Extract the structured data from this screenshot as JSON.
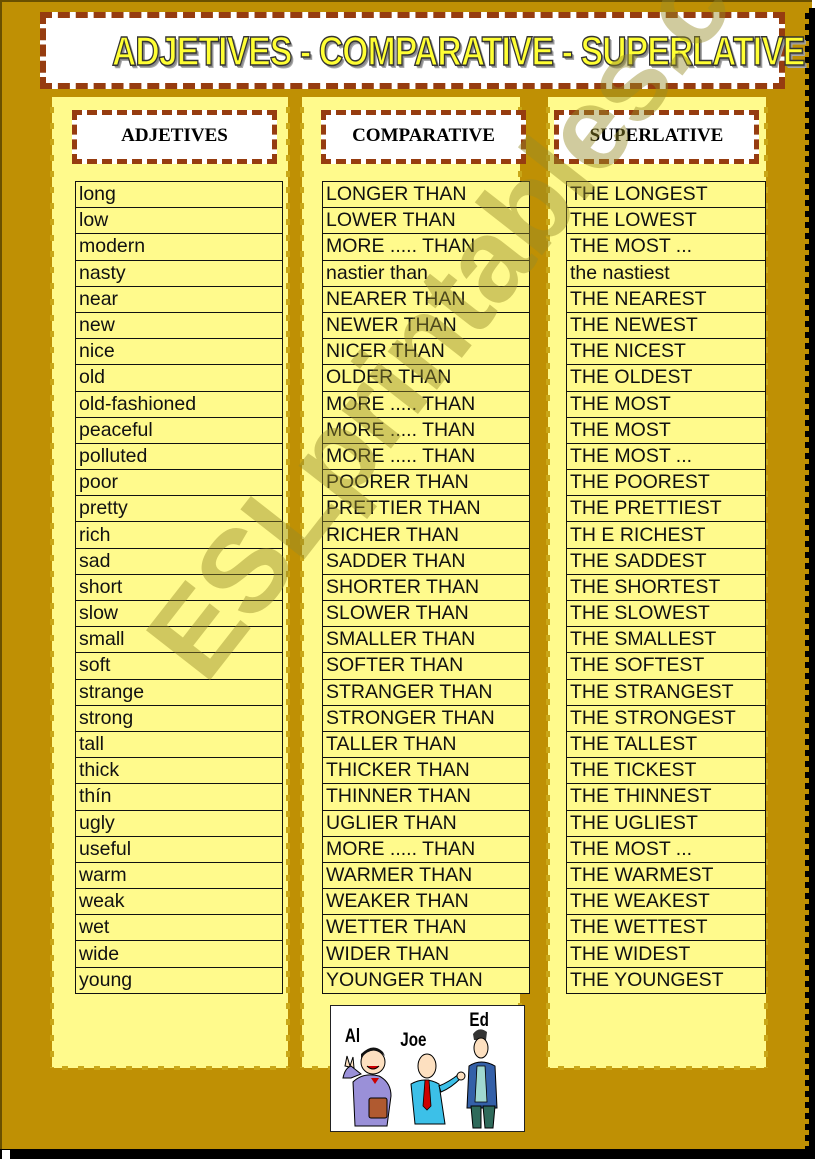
{
  "title": "ADJETIVES - COMPARATIVE - SUPERLATIVE",
  "columns": {
    "adjectives": "ADJETIVES",
    "comparative": "COMPARATIVE",
    "superlative": "SUPERLATIVE"
  },
  "rows": [
    {
      "adj": "long",
      "comp": "LONGER THAN",
      "sup": "THE LONGEST"
    },
    {
      "adj": "low",
      "comp": "LOWER THAN",
      "sup": "THE  LOWEST"
    },
    {
      "adj": "modern",
      "comp": "MORE ..... THAN",
      "sup": "THE  MOST ..."
    },
    {
      "adj": "nasty",
      "comp": "nastier than",
      "sup": "the nastiest"
    },
    {
      "adj": "near",
      "comp": "NEARER THAN",
      "sup": "THE NEAREST"
    },
    {
      "adj": "new",
      "comp": "NEWER THAN",
      "sup": "THE NEWEST"
    },
    {
      "adj": "nice",
      "comp": "NICER THAN",
      "sup": "THE NICEST"
    },
    {
      "adj": "old",
      "comp": "OLDER THAN",
      "sup": "THE OLDEST"
    },
    {
      "adj": "old-fashioned",
      "comp": "MORE ..... THAN",
      "sup": "THE MOST"
    },
    {
      "adj": "peaceful",
      "comp": "MORE ..... THAN",
      "sup": "THE MOST"
    },
    {
      "adj": "polluted",
      "comp": "MORE ..... THAN",
      "sup": "THE  MOST ..."
    },
    {
      "adj": "poor",
      "comp": "POORER THAN",
      "sup": "THE POOREST"
    },
    {
      "adj": "pretty",
      "comp": "PRETTIER THAN",
      "sup": "THE PRETTIEST"
    },
    {
      "adj": "rich",
      "comp": "RICHER THAN",
      "sup": "TH E RICHEST"
    },
    {
      "adj": "sad",
      "comp": "SADDER THAN",
      "sup": "THE SADDEST"
    },
    {
      "adj": "short",
      "comp": "SHORTER THAN",
      "sup": "THE SHORTEST"
    },
    {
      "adj": "slow",
      "comp": "SLOWER THAN",
      "sup": "THE SLOWEST"
    },
    {
      "adj": "small",
      "comp": "SMALLER THAN",
      "sup": "THE SMALLEST"
    },
    {
      "adj": "soft",
      "comp": "SOFTER THAN",
      "sup": "THE SOFTEST"
    },
    {
      "adj": "strange",
      "comp": "STRANGER THAN",
      "sup": "THE STRANGEST"
    },
    {
      "adj": "strong",
      "comp": "STRONGER THAN",
      "sup": "THE STRONGEST"
    },
    {
      "adj": "tall",
      "comp": "TALLER THAN",
      "sup": "THE TALLEST"
    },
    {
      "adj": "thick",
      "comp": "THICKER THAN",
      "sup": "THE TICKEST"
    },
    {
      "adj": "thín",
      "comp": "THINNER THAN",
      "sup": "THE THINNEST"
    },
    {
      "adj": "ugly",
      "comp": "UGLIER THAN",
      "sup": "THE UGLIEST"
    },
    {
      "adj": "useful",
      "comp": "MORE ..... THAN",
      "sup": "THE  MOST ..."
    },
    {
      "adj": "warm",
      "comp": "WARMER THAN",
      "sup": "THE WARMEST"
    },
    {
      "adj": "weak",
      "comp": "WEAKER THAN",
      "sup": "THE WEAKEST"
    },
    {
      "adj": "wet",
      "comp": "WETTER THAN",
      "sup": "THE WETTEST"
    },
    {
      "adj": "wide",
      "comp": "WIDER THAN",
      "sup": "THE WIDEST"
    },
    {
      "adj": "young",
      "comp": "YOUNGER THAN",
      "sup": "THE YOUNGEST"
    }
  ],
  "illustration": {
    "labels": [
      "Al",
      "Joe",
      "Ed"
    ]
  },
  "watermark": "ESLprintables.com",
  "colors": {
    "page_background": "#BF9004",
    "panel_yellow": "#FFFA8C",
    "dashed_border": "#963C10",
    "title_fill": "#FFFF33"
  }
}
